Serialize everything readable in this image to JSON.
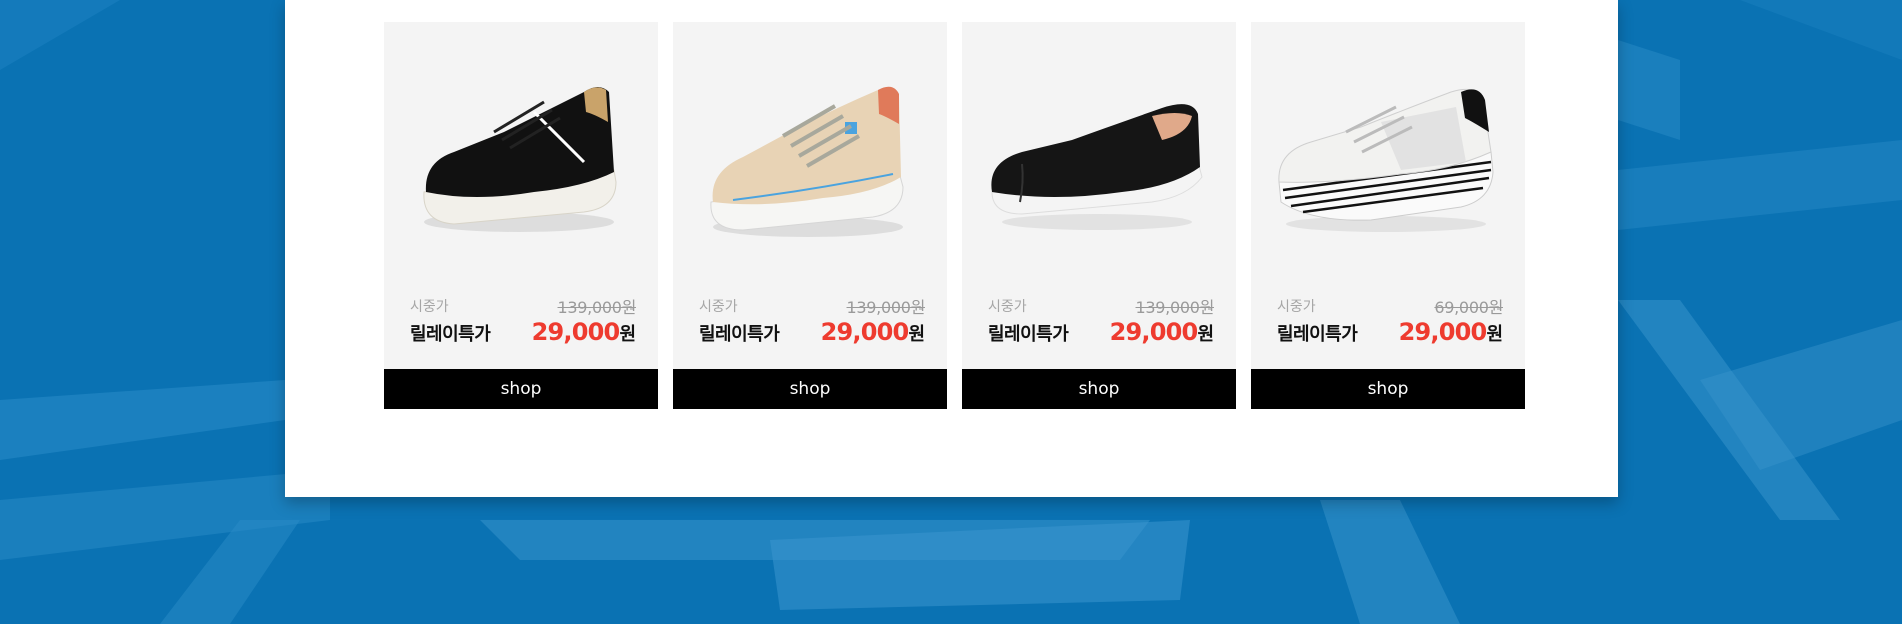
{
  "colors": {
    "background": "#0a72b3",
    "panel": "#ffffff",
    "card": "#f4f4f4",
    "sale_price": "#ee3b2f",
    "button": "#000000"
  },
  "products": [
    {
      "image_icon": "black-leather-sneaker",
      "market_label": "시중가",
      "market_price": "139,000원",
      "relay_label": "릴레이특가",
      "sale_price": "29,000",
      "sale_unit": "원",
      "button_label": "shop"
    },
    {
      "image_icon": "beige-leather-sneaker",
      "market_label": "시중가",
      "market_price": "139,000원",
      "relay_label": "릴레이특가",
      "sale_price": "29,000",
      "sale_unit": "원",
      "button_label": "shop"
    },
    {
      "image_icon": "black-slip-on",
      "market_label": "시중가",
      "market_price": "139,000원",
      "relay_label": "릴레이특가",
      "sale_price": "29,000",
      "sale_unit": "원",
      "button_label": "shop"
    },
    {
      "image_icon": "white-platform-sneaker",
      "market_label": "시중가",
      "market_price": "69,000원",
      "relay_label": "릴레이특가",
      "sale_price": "29,000",
      "sale_unit": "원",
      "button_label": "shop"
    }
  ]
}
